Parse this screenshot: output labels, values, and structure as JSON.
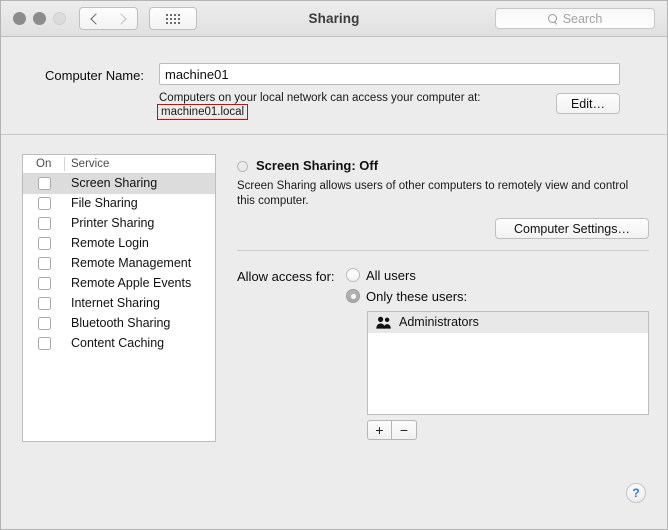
{
  "window": {
    "title": "Sharing",
    "traffic_lights": [
      "close",
      "minimize",
      "zoom"
    ]
  },
  "toolbar": {
    "back_icon": "chevron-left-icon",
    "forward_icon": "chevron-right-icon",
    "grid_icon": "show-all-grid-icon",
    "search": {
      "placeholder": "Search",
      "value": "",
      "icon": "search-icon"
    }
  },
  "computer_name": {
    "label": "Computer Name:",
    "value": "machine01",
    "hint": "Computers on your local network can access your computer at:",
    "local_hostname": "machine01.local",
    "highlight_color": "#e40000",
    "edit_button": "Edit…"
  },
  "services": {
    "columns": [
      "On",
      "Service"
    ],
    "selected": "Screen Sharing",
    "items": [
      {
        "name": "Screen Sharing",
        "on": false
      },
      {
        "name": "File Sharing",
        "on": false
      },
      {
        "name": "Printer Sharing",
        "on": false
      },
      {
        "name": "Remote Login",
        "on": false
      },
      {
        "name": "Remote Management",
        "on": false
      },
      {
        "name": "Remote Apple Events",
        "on": false
      },
      {
        "name": "Internet Sharing",
        "on": false
      },
      {
        "name": "Bluetooth Sharing",
        "on": false
      },
      {
        "name": "Content Caching",
        "on": false
      }
    ]
  },
  "detail": {
    "status_title": "Screen Sharing: Off",
    "status_indicator": "off",
    "description": "Screen Sharing allows users of other computers to remotely view and control this computer.",
    "computer_settings_button": "Computer Settings…"
  },
  "access": {
    "label": "Allow access for:",
    "options": [
      {
        "label": "All users",
        "selected": false
      },
      {
        "label": "Only these users:",
        "selected": true
      }
    ],
    "users": [
      {
        "name": "Administrators",
        "icon": "group-users-icon"
      }
    ],
    "add_button": "+",
    "remove_button": "−"
  },
  "help": {
    "label": "?"
  }
}
